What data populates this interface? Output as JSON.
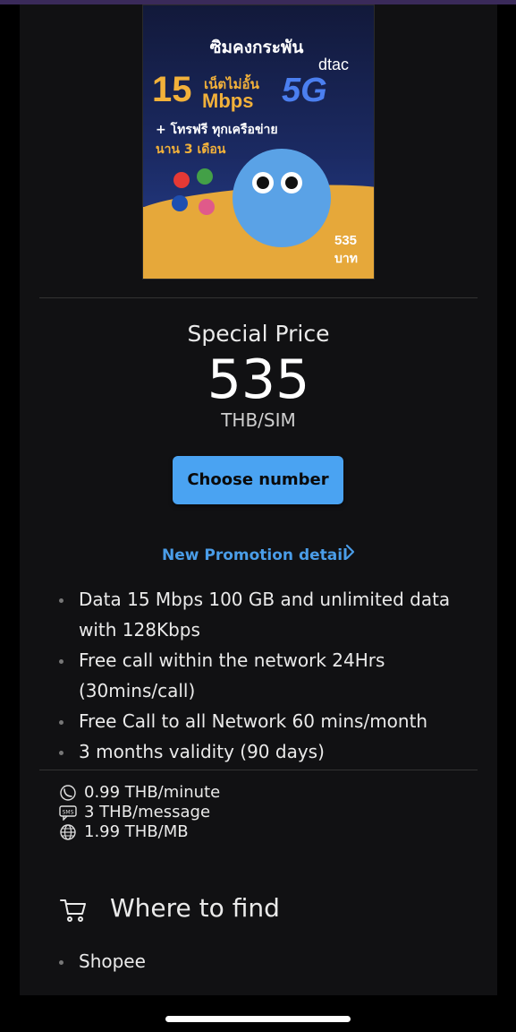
{
  "sim_card": {
    "title": "ซิมคงกระพัน",
    "speed_number": "15",
    "speed_thai": "เน็ตไม่อั้น",
    "speed_unit": "Mbps",
    "brand": "dtac",
    "network": "5G",
    "call_text": "+ โทรฟรี ทุกเครือข่าย",
    "duration_text": "นาน 3 เดือน",
    "price": "535",
    "price_unit": "บาท"
  },
  "offer": {
    "special_label": "Special Price",
    "price": "535",
    "unit": "THB/SIM",
    "choose_button": "Choose number",
    "promo_link": "New Promotion detail"
  },
  "features": [
    "Data 15 Mbps 100 GB and unlimited data with 128Kbps",
    "Free call within the network 24Hrs (30mins/call)",
    "Free Call to all Network 60 mins/month",
    "3 months validity (90 days)"
  ],
  "rates": {
    "call": "0.99 THB/minute",
    "sms": "3 THB/message",
    "data": "1.99 THB/MB",
    "sms_icon_text": "SMS"
  },
  "where_to_find": {
    "title": "Where to find",
    "items": [
      "Shopee"
    ]
  },
  "colors": {
    "accent_button": "#4aa3f2",
    "link": "#4a9de8",
    "background": "#111113"
  },
  "icons": [
    "cart-icon",
    "phone-call-icon",
    "sms-icon",
    "globe-icon",
    "chevron-right-icon"
  ]
}
